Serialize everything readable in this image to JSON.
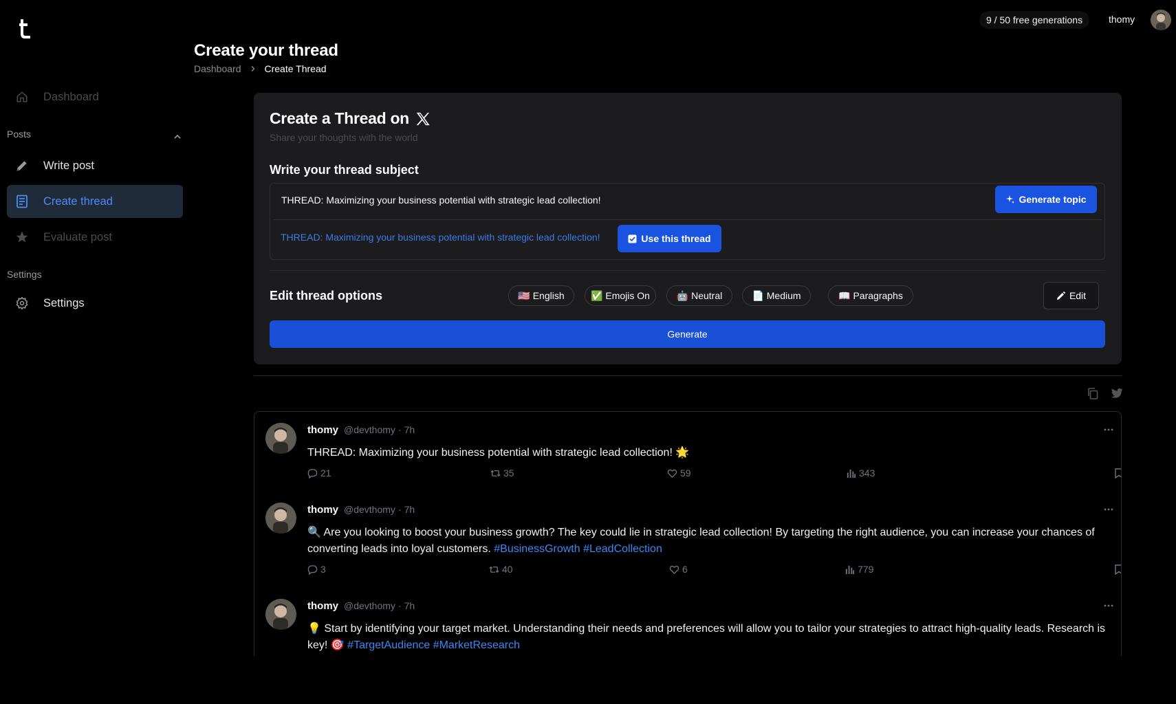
{
  "topbar": {
    "generations": "9 / 50 free generations",
    "username": "thomy"
  },
  "sidebar": {
    "dashboard": "Dashboard",
    "posts_section": "Posts",
    "write_post": "Write post",
    "create_thread": "Create thread",
    "evaluate_post": "Evaluate post",
    "settings_section": "Settings",
    "settings": "Settings"
  },
  "page": {
    "title": "Create your thread",
    "breadcrumb": [
      "Dashboard",
      "Create Thread"
    ]
  },
  "card": {
    "title": "Create a Thread on",
    "subtitle": "Share your thoughts with the world",
    "subject_label": "Write your thread subject",
    "subject_value": "THREAD: Maximizing your business potential with strategic lead collection!",
    "generate_topic": "Generate topic",
    "suggestion": "THREAD: Maximizing your business potential with strategic lead collection!",
    "use_thread": "Use this thread",
    "options_label": "Edit thread options",
    "options": [
      "🇺🇸 English",
      "✅ Emojis On",
      "🤖 Neutral",
      "📄 Medium",
      "📖 Paragraphs"
    ],
    "edit": "Edit",
    "generate": "Generate"
  },
  "tweets": [
    {
      "name": "thomy",
      "handle": "@devthomy",
      "dot": "·",
      "time": "7h",
      "text": "THREAD: Maximizing your business potential with strategic lead collection! 🌟",
      "tags": "",
      "replies": "21",
      "retweets": "35",
      "likes": "59",
      "views": "343"
    },
    {
      "name": "thomy",
      "handle": "@devthomy",
      "dot": "·",
      "time": "7h",
      "text": "🔍 Are you looking to boost your business growth? The key could lie in strategic lead collection! By targeting the right audience, you can increase your chances of converting leads into loyal customers.",
      "tags": "#BusinessGrowth #LeadCollection",
      "replies": "3",
      "retweets": "40",
      "likes": "6",
      "views": "779"
    },
    {
      "name": "thomy",
      "handle": "@devthomy",
      "dot": "·",
      "time": "7h",
      "text": "💡 Start by identifying your target market. Understanding their needs and preferences will allow you to tailor your strategies to attract high-quality leads. Research is key! 🎯",
      "tags": "#TargetAudience #MarketResearch"
    }
  ],
  "colors": {
    "accent": "#1a53e0",
    "active_nav_bg": "#1f2a3b",
    "active_nav_text": "#4e8cf3",
    "hashtag": "#3d87f5"
  },
  "icons": [
    "logo-icon",
    "home-icon",
    "pencil-icon",
    "document-icon",
    "star-icon",
    "gear-icon",
    "chevron-up-icon",
    "chevron-right-icon",
    "x-logo-icon",
    "sparkle-icon",
    "checkbox-icon",
    "edit-icon",
    "copy-icon",
    "twitter-icon",
    "reply-icon",
    "retweet-icon",
    "heart-icon",
    "views-icon",
    "bookmark-icon",
    "share-icon",
    "more-icon"
  ]
}
